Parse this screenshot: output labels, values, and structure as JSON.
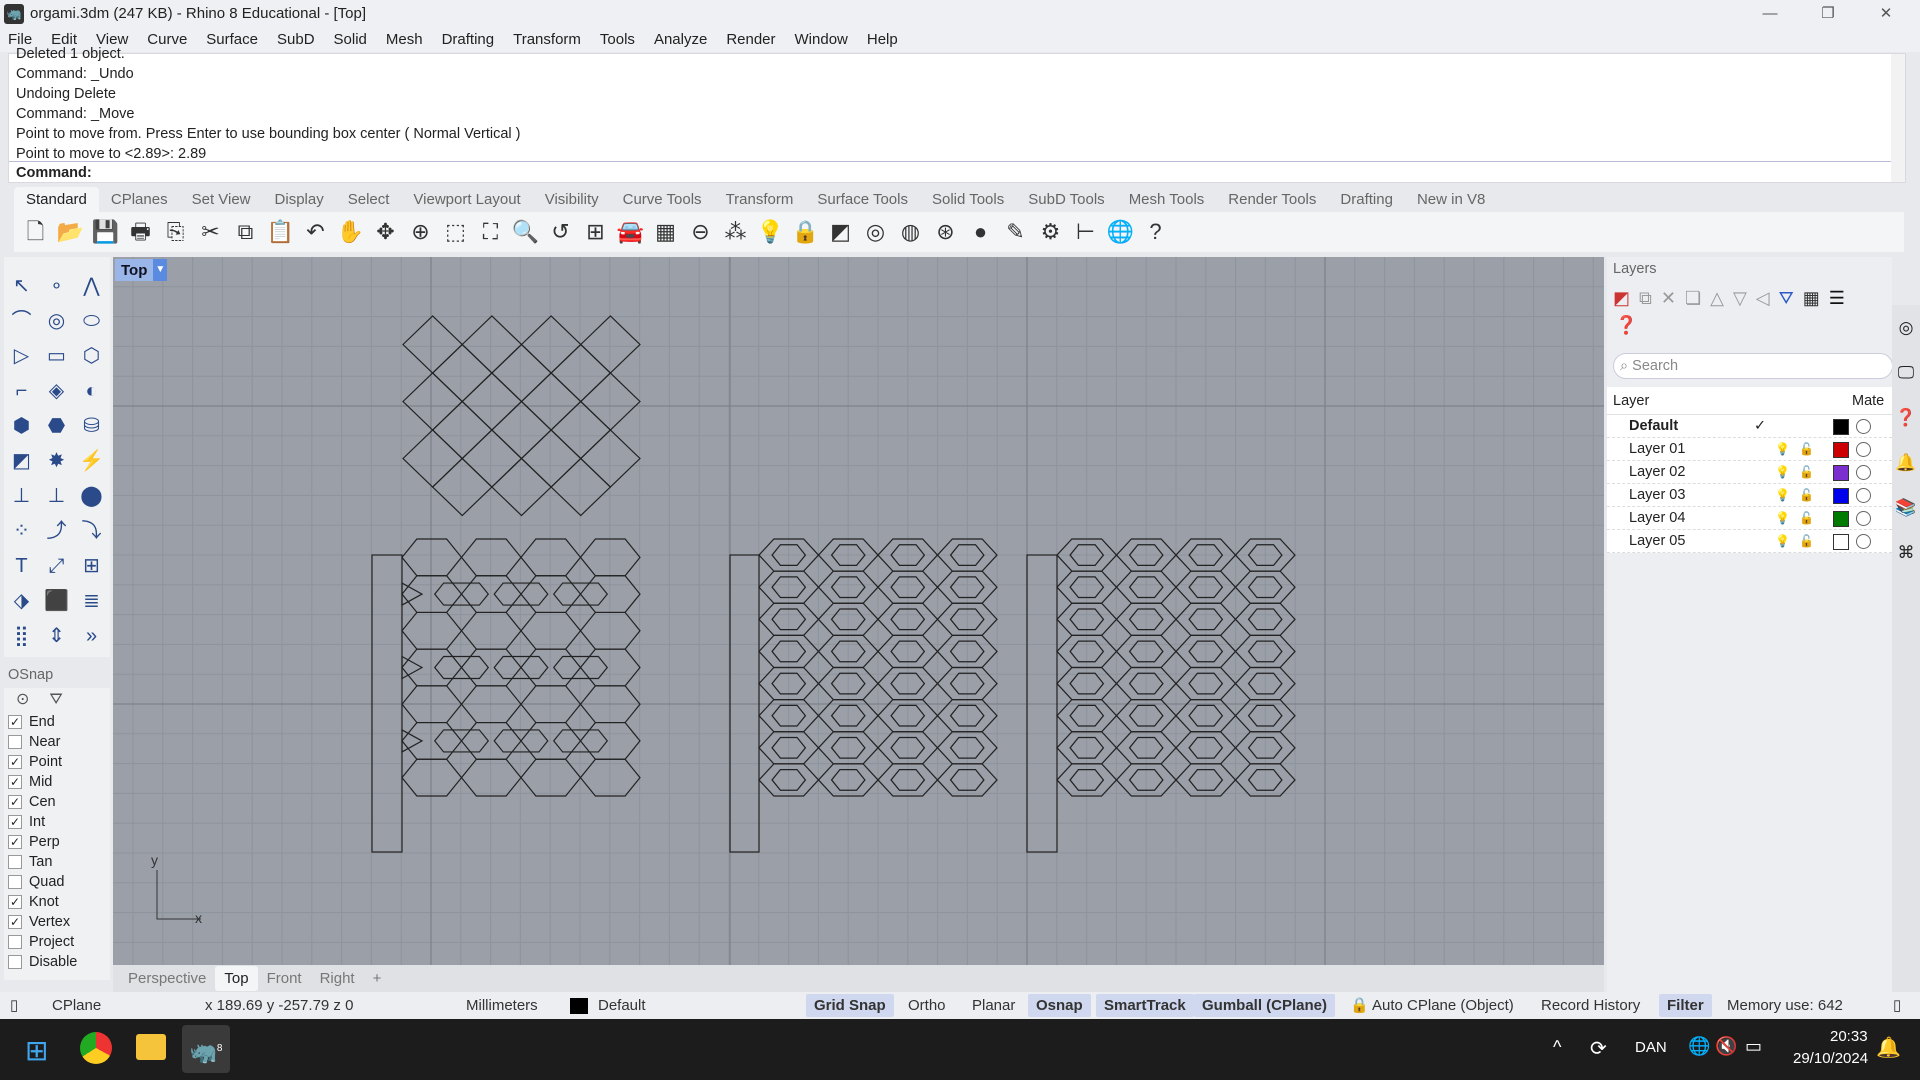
{
  "window": {
    "title": "orgami.3dm (247 KB) - Rhino 8 Educational - [Top]",
    "minimize": "—",
    "restore": "❐",
    "close": "✕"
  },
  "menu": [
    "File",
    "Edit",
    "View",
    "Curve",
    "Surface",
    "SubD",
    "Solid",
    "Mesh",
    "Drafting",
    "Transform",
    "Tools",
    "Analyze",
    "Render",
    "Window",
    "Help"
  ],
  "command_history": [
    "Deleted 1 object.",
    "Command: _Undo",
    "Undoing Delete",
    "Command: _Move",
    "Point to move from. Press Enter to use bounding box center ( Normal  Vertical )",
    "Point to move to <2.89>: 2.89"
  ],
  "command_prompt": "Command:",
  "toolbar_tabs": [
    "Standard",
    "CPlanes",
    "Set View",
    "Display",
    "Select",
    "Viewport Layout",
    "Visibility",
    "Curve Tools",
    "Transform",
    "Surface Tools",
    "Solid Tools",
    "SubD Tools",
    "Mesh Tools",
    "Render Tools",
    "Drafting",
    "New in V8"
  ],
  "active_toolbar_tab": "Standard",
  "toolbar_icons": [
    [
      "new-icon",
      "🗋"
    ],
    [
      "open-icon",
      "📂"
    ],
    [
      "save-icon",
      "💾"
    ],
    [
      "print-icon",
      "🖶"
    ],
    [
      "export-icon",
      "⎘"
    ],
    [
      "cut-icon",
      "✂"
    ],
    [
      "copy-icon",
      "⧉"
    ],
    [
      "paste-icon",
      "📋"
    ],
    [
      "undo-icon",
      "↶"
    ],
    [
      "pan-icon",
      "✋"
    ],
    [
      "rotate-view-icon",
      "✥"
    ],
    [
      "zoom-icon",
      "⊕"
    ],
    [
      "zoom-window-icon",
      "⬚"
    ],
    [
      "zoom-extents-icon",
      "⛶"
    ],
    [
      "zoom-selected-icon",
      "🔍"
    ],
    [
      "undo-view-icon",
      "↺"
    ],
    [
      "four-viewports-icon",
      "⊞"
    ],
    [
      "car-icon",
      "🚘"
    ],
    [
      "cplane-icon",
      "▦"
    ],
    [
      "snap-icon",
      "⊖"
    ],
    [
      "points-icon",
      "⁂"
    ],
    [
      "light-icon",
      "💡"
    ],
    [
      "lock-icon",
      "🔒"
    ],
    [
      "layer-icon",
      "◩"
    ],
    [
      "color-wheel-icon",
      "◎"
    ],
    [
      "sphere-wire-icon",
      "◍"
    ],
    [
      "sphere-grid-icon",
      "⊛"
    ],
    [
      "render-sphere-icon",
      "●"
    ],
    [
      "pen-icon",
      "✎"
    ],
    [
      "gear-icon",
      "⚙"
    ],
    [
      "dimension-icon",
      "⊢"
    ],
    [
      "globe-icon",
      "🌐"
    ],
    [
      "help-icon",
      "?"
    ]
  ],
  "left_tools": [
    "↖",
    "∘",
    "⋀",
    "⌒",
    "◎",
    "⬭",
    "▷",
    "▭",
    "⬡",
    "⌐",
    "◈",
    "◐",
    "⬢",
    "⬣",
    "⛁",
    "◩",
    "✸",
    "⚡",
    "⊥",
    "⊥",
    "⬤",
    "⁘",
    "⤴",
    "⤵",
    "T",
    "⤢",
    "⊞",
    "⬗",
    "⬛",
    "≣",
    "⣿",
    "⇕",
    "»"
  ],
  "osnap": {
    "title": "OSnap",
    "items": [
      {
        "label": "End",
        "checked": true
      },
      {
        "label": "Near",
        "checked": false
      },
      {
        "label": "Point",
        "checked": true
      },
      {
        "label": "Mid",
        "checked": true
      },
      {
        "label": "Cen",
        "checked": true
      },
      {
        "label": "Int",
        "checked": true
      },
      {
        "label": "Perp",
        "checked": true
      },
      {
        "label": "Tan",
        "checked": false
      },
      {
        "label": "Quad",
        "checked": false
      },
      {
        "label": "Knot",
        "checked": true
      },
      {
        "label": "Vertex",
        "checked": true
      },
      {
        "label": "Project",
        "checked": false
      },
      {
        "label": "Disable",
        "checked": false
      }
    ]
  },
  "viewport": {
    "name": "Top",
    "axis_x": "x",
    "axis_y": "y"
  },
  "viewport_tabs": [
    "Perspective",
    "Top",
    "Front",
    "Right",
    "+"
  ],
  "active_viewport_tab": "Top",
  "layers": {
    "title": "Layers",
    "search_placeholder": "Search",
    "col_layer": "Layer",
    "col_material": "Mate",
    "rows": [
      {
        "name": "Default",
        "current": true,
        "color": "#000000"
      },
      {
        "name": "Layer 01",
        "color": "#cc0000"
      },
      {
        "name": "Layer 02",
        "color": "#7b2fcf"
      },
      {
        "name": "Layer 03",
        "color": "#0000ee"
      },
      {
        "name": "Layer 04",
        "color": "#007a00"
      },
      {
        "name": "Layer 05",
        "color": "#ffffff"
      }
    ],
    "checkmark": "✓",
    "bulb": "💡",
    "lock": "🔓"
  },
  "status": {
    "cplane": "CPlane",
    "coords": "x 189.69  y -257.79  z 0",
    "units": "Millimeters",
    "layer": "Default",
    "grid_snap": "Grid Snap",
    "ortho": "Ortho",
    "planar": "Planar",
    "osnap": "Osnap",
    "smarttrack": "SmartTrack",
    "gumball": "Gumball (CPlane)",
    "auto_cplane": "Auto CPlane (Object)",
    "record_history": "Record History",
    "filter": "Filter",
    "memory": "Memory use: 642"
  },
  "taskbar": {
    "lang": "DAN",
    "time": "20:33",
    "date": "29/10/2024",
    "rhino_badge": "8"
  }
}
